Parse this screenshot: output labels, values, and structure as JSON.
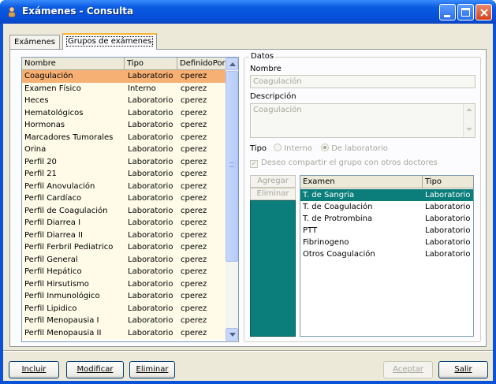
{
  "window": {
    "title": "Exámenes - Consulta",
    "icon": "user-icon"
  },
  "tabs": [
    {
      "label": "Exámenes"
    },
    {
      "label": "Grupos de exámenes",
      "active": true
    }
  ],
  "groups_list": {
    "columns": [
      "Nombre",
      "Tipo",
      "DefinidoPor"
    ],
    "rows": [
      {
        "nombre": "Coagulación",
        "tipo": "Laboratorio",
        "definido": "cperez",
        "selected": true
      },
      {
        "nombre": "Examen Físico",
        "tipo": "Interno",
        "definido": "cperez"
      },
      {
        "nombre": "Heces",
        "tipo": "Laboratorio",
        "definido": "cperez"
      },
      {
        "nombre": "Hematológicos",
        "tipo": "Laboratorio",
        "definido": "cperez"
      },
      {
        "nombre": "Hormonas",
        "tipo": "Laboratorio",
        "definido": "cperez"
      },
      {
        "nombre": "Marcadores Tumorales",
        "tipo": "Laboratorio",
        "definido": "cperez"
      },
      {
        "nombre": "Orina",
        "tipo": "Laboratorio",
        "definido": "cperez"
      },
      {
        "nombre": "Perfil 20",
        "tipo": "Laboratorio",
        "definido": "cperez"
      },
      {
        "nombre": "Perfil 21",
        "tipo": "Laboratorio",
        "definido": "cperez"
      },
      {
        "nombre": "Perfil Anovulación",
        "tipo": "Laboratorio",
        "definido": "cperez"
      },
      {
        "nombre": "Perfil Cardíaco",
        "tipo": "Laboratorio",
        "definido": "cperez"
      },
      {
        "nombre": "Perfil de Coagulación",
        "tipo": "Laboratorio",
        "definido": "cperez"
      },
      {
        "nombre": "Perfil Diarrea I",
        "tipo": "Laboratorio",
        "definido": "cperez"
      },
      {
        "nombre": "Perfil Diarrea II",
        "tipo": "Laboratorio",
        "definido": "cperez"
      },
      {
        "nombre": "Perfil Ferbril Pediatrico",
        "tipo": "Laboratorio",
        "definido": "cperez"
      },
      {
        "nombre": "Perfil General",
        "tipo": "Laboratorio",
        "definido": "cperez"
      },
      {
        "nombre": "Perfil Hepático",
        "tipo": "Laboratorio",
        "definido": "cperez"
      },
      {
        "nombre": "Perfil Hirsutismo",
        "tipo": "Laboratorio",
        "definido": "cperez"
      },
      {
        "nombre": "Perfil Inmunológico",
        "tipo": "Laboratorio",
        "definido": "cperez"
      },
      {
        "nombre": "Perfil Lipidico",
        "tipo": "Laboratorio",
        "definido": "cperez"
      },
      {
        "nombre": "Perfil Menopausia I",
        "tipo": "Laboratorio",
        "definido": "cperez"
      },
      {
        "nombre": "Perfil Menopausia II",
        "tipo": "Laboratorio",
        "definido": "cperez"
      }
    ]
  },
  "datos": {
    "legend": "Datos",
    "nombre_label": "Nombre",
    "nombre_value": "Coagulación",
    "descripcion_label": "Descripción",
    "descripcion_value": "Coagulación",
    "tipo_label": "Tipo",
    "tipo_interno": "Interno",
    "tipo_laboratorio": "De laboratorio",
    "compartir_label": "Deseo compartir el grupo con otros doctores",
    "agregar_label": "Agregar",
    "eliminar_label": "Eliminar"
  },
  "exam_list": {
    "columns": [
      "Examen",
      "Tipo"
    ],
    "rows": [
      {
        "examen": "T. de Sangria",
        "tipo": "Laboratorio",
        "selected": true
      },
      {
        "examen": "T. de Coagulación",
        "tipo": "Laboratorio"
      },
      {
        "examen": "T. de Protrombina",
        "tipo": "Laboratorio"
      },
      {
        "examen": "PTT",
        "tipo": "Laboratorio"
      },
      {
        "examen": "Fibrinogeno",
        "tipo": "Laboratorio"
      },
      {
        "examen": "Otros Coagulación",
        "tipo": "Laboratorio"
      }
    ]
  },
  "footer": {
    "incluir": "Incluir",
    "modificar": "Modificar",
    "eliminar": "Eliminar",
    "aceptar": "Aceptar",
    "salir": "Salir"
  },
  "colors": {
    "selection_list": "#f7b073",
    "list_bg": "#fffbe8",
    "teal": "#0b7e7b",
    "titlebar": "#0550dc"
  }
}
